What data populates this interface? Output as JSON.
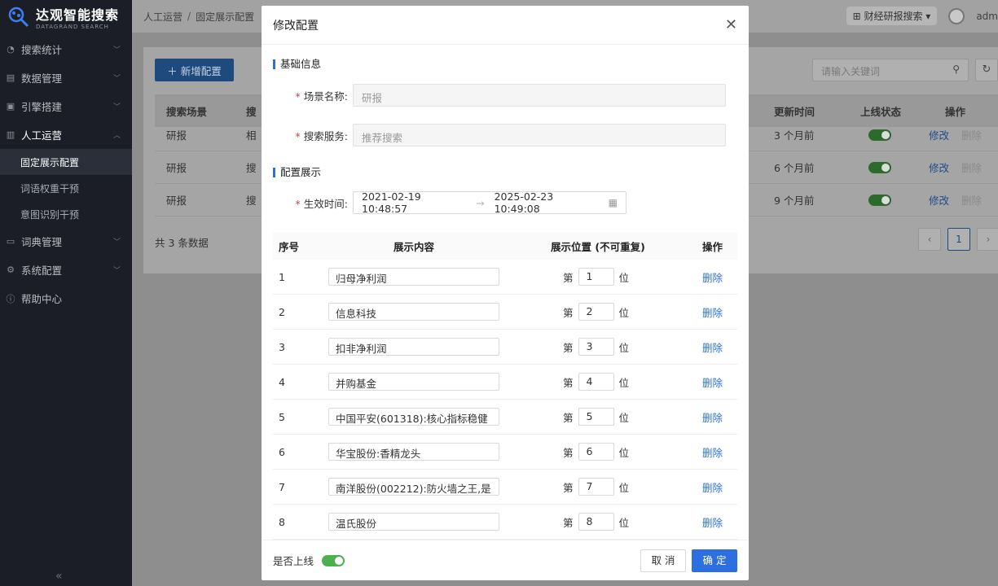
{
  "brand": {
    "name": "达观智能搜索",
    "sub": "DATAGRAND SEARCH"
  },
  "sidebar": {
    "items": [
      {
        "icon": "chart-pie-icon",
        "label": "搜索统计"
      },
      {
        "icon": "database-icon",
        "label": "数据管理"
      },
      {
        "icon": "engine-icon",
        "label": "引擎搭建"
      },
      {
        "icon": "ops-icon",
        "label": "人工运营",
        "open": true
      },
      {
        "icon": "dictionary-icon",
        "label": "词典管理"
      },
      {
        "icon": "gear-icon",
        "label": "系统配置"
      },
      {
        "icon": "info-icon",
        "label": "帮助中心"
      }
    ],
    "subitems": [
      "固定展示配置",
      "词语权重干预",
      "意图识别干预"
    ]
  },
  "breadcrumb": {
    "root": "人工运营",
    "current": "固定展示配置"
  },
  "topbar": {
    "app_switch": "财经研报搜索",
    "user": "adm"
  },
  "list": {
    "add_button": "新增配置",
    "search_placeholder": "请输入关键词",
    "headers": {
      "scene": "搜索场景",
      "col2": "搜",
      "update_time": "更新时间",
      "online_status": "上线状态",
      "actions": "操作"
    },
    "rows": [
      {
        "scene": "研报",
        "col2": "相",
        "time": "3 个月前",
        "edit": "修改",
        "del": "删除"
      },
      {
        "scene": "研报",
        "col2": "搜",
        "time": "6 个月前",
        "edit": "修改",
        "del": "删除"
      },
      {
        "scene": "研报",
        "col2": "搜",
        "time": "9 个月前",
        "edit": "修改",
        "del": "删除"
      }
    ],
    "total": "共 3 条数据",
    "page": "1"
  },
  "modal": {
    "title": "修改配置",
    "section_basic": "基础信息",
    "scene_label": "场景名称:",
    "scene_placeholder": "研报",
    "service_label": "搜索服务:",
    "service_placeholder": "推荐搜索",
    "section_display": "配置展示",
    "time_label": "生效时间:",
    "time_start": "2021-02-19 10:48:57",
    "time_end": "2025-02-23 10:49:08",
    "table_headers": {
      "idx": "序号",
      "content": "展示内容",
      "position": "展示位置 (不可重复)",
      "op": "操作"
    },
    "pos_prefix": "第",
    "pos_suffix": "位",
    "rows": [
      {
        "idx": "1",
        "content": "归母净利润",
        "pos": "1",
        "op": "删除"
      },
      {
        "idx": "2",
        "content": "信息科技",
        "pos": "2",
        "op": "删除"
      },
      {
        "idx": "3",
        "content": "扣非净利润",
        "pos": "3",
        "op": "删除"
      },
      {
        "idx": "4",
        "content": "并购基金",
        "pos": "4",
        "op": "删除"
      },
      {
        "idx": "5",
        "content": "中国平安(601318):核心指标稳健",
        "pos": "5",
        "op": "删除"
      },
      {
        "idx": "6",
        "content": "华宝股份:香精龙头",
        "pos": "6",
        "op": "删除"
      },
      {
        "idx": "7",
        "content": "南洋股份(002212):防火墙之王,是",
        "pos": "7",
        "op": "删除"
      },
      {
        "idx": "8",
        "content": "温氏股份",
        "pos": "8",
        "op": "删除"
      }
    ],
    "online_label": "是否上线",
    "cancel": "取 消",
    "ok": "确 定"
  },
  "colors": {
    "primary": "#2d6fde",
    "sidebar_bg": "#1b1e26",
    "toggle_on": "#4caf50"
  }
}
